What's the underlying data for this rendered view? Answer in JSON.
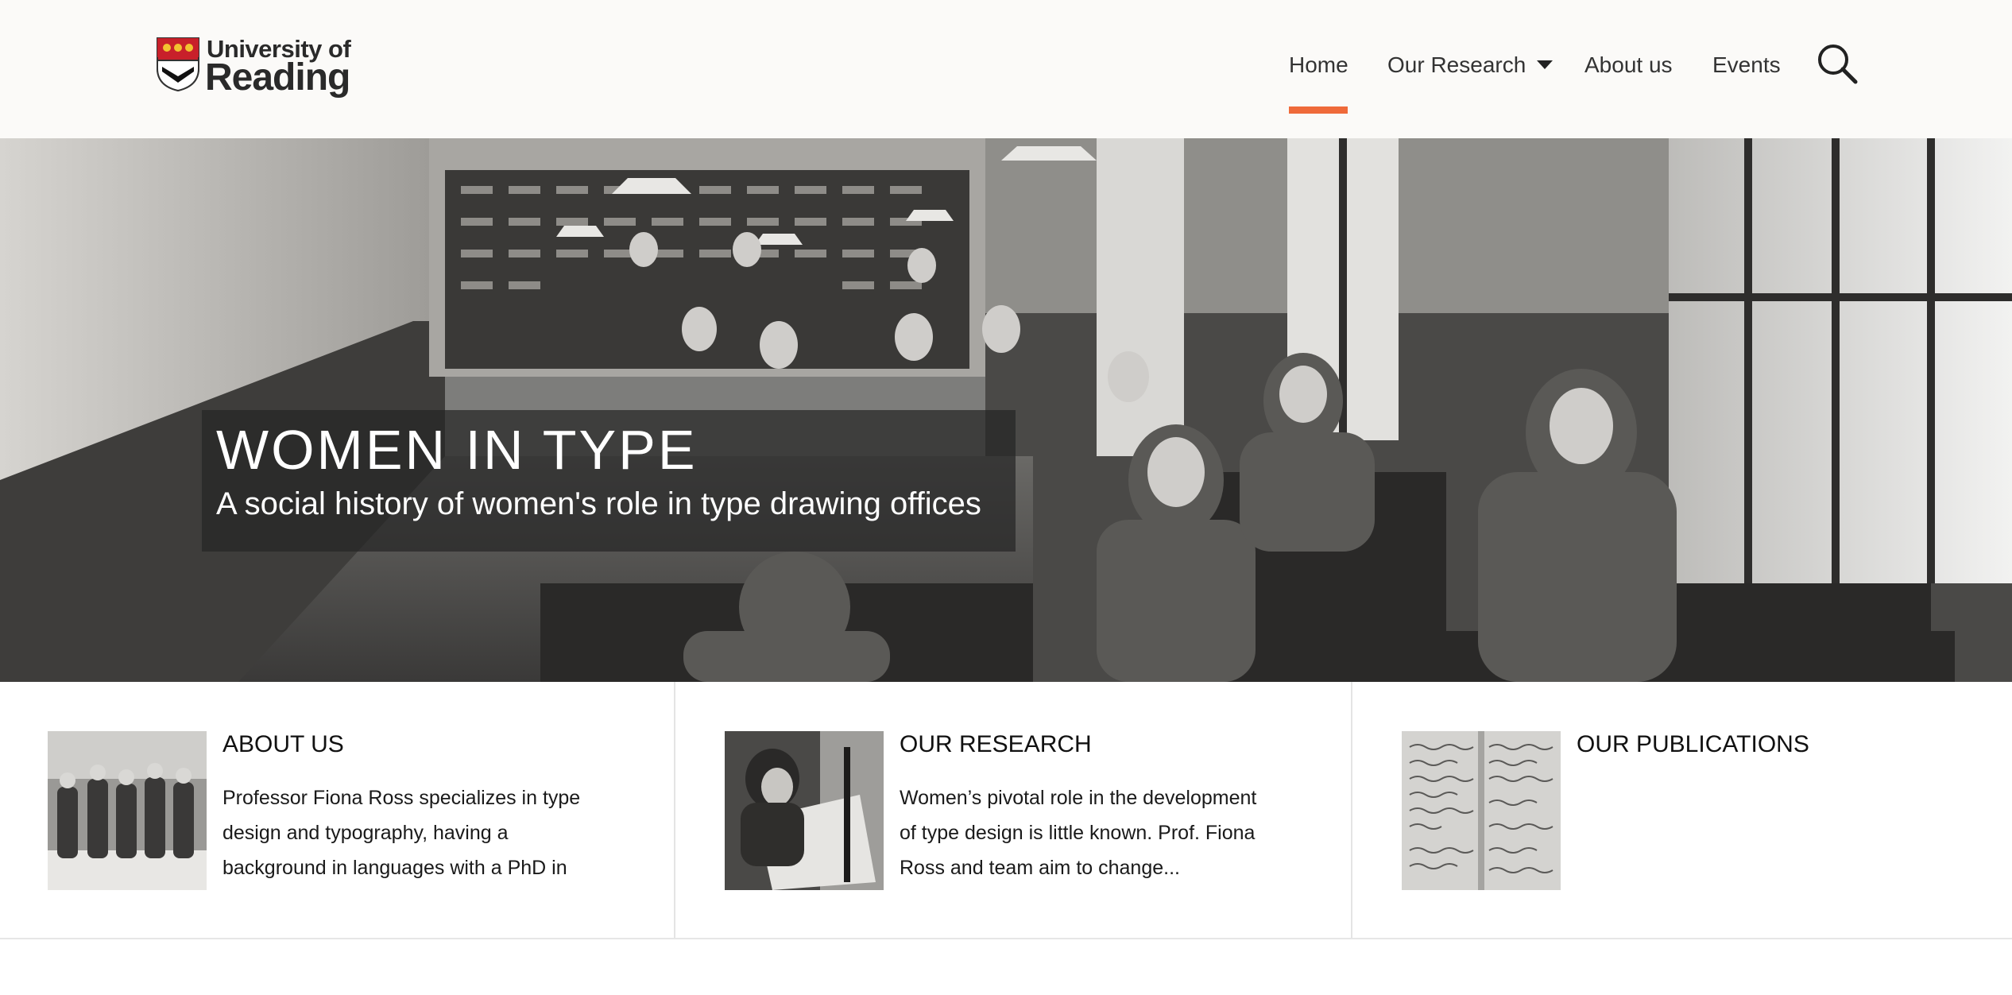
{
  "brand": {
    "line1": "University of",
    "line2": "Reading",
    "accent": "#ef6a3a"
  },
  "nav": {
    "items": [
      {
        "label": "Home",
        "active": true
      },
      {
        "label": "Our Research",
        "has_dropdown": true
      },
      {
        "label": "About us"
      },
      {
        "label": "Events"
      }
    ],
    "search_icon": "search-icon",
    "dropdown_icon": "caret-down-icon"
  },
  "hero": {
    "title": "WOMEN IN TYPE",
    "subtitle": "A social history of women's role in type drawing offices"
  },
  "cards": [
    {
      "title": "ABOUT US",
      "text": "Professor Fiona Ross specializes in type design and typography, having a background in languages with a PhD in"
    },
    {
      "title": "OUR RESEARCH",
      "text": "Women’s pivotal role in the development of type design is little known. Prof. Fiona Ross and team aim to change..."
    },
    {
      "title": "OUR PUBLICATIONS",
      "text": ""
    }
  ]
}
